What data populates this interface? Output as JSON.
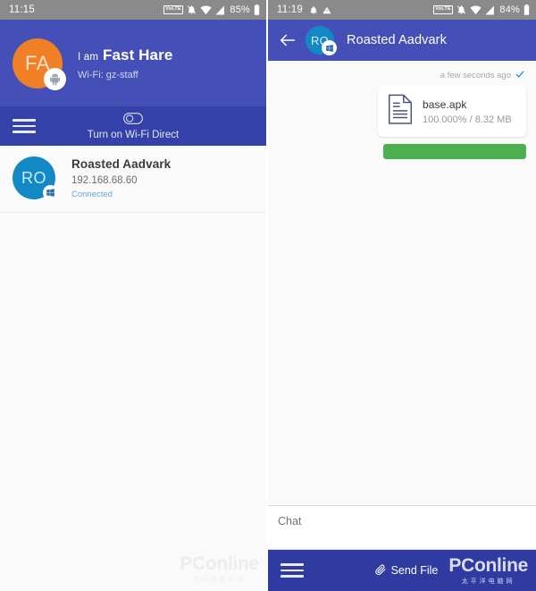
{
  "left_screen": {
    "status_bar": {
      "time": "11:15",
      "battery_percent": "85%",
      "icons": [
        "volte-icon",
        "notifications-muted-icon",
        "wifi-icon",
        "cellular-signal-icon",
        "battery-icon"
      ],
      "volte_label": "VoLTE"
    },
    "profile": {
      "avatar_initials": "FA",
      "avatar_color": "#ef8026",
      "badge_icon": "android-icon",
      "prefix": "I am",
      "name": "Fast Hare",
      "network": "Wi-Fi: gz-staff"
    },
    "wifi_direct_bar": {
      "menu_icon": "hamburger-menu-icon",
      "toggle_icon": "toggle-off-icon",
      "label": "Turn on Wi-Fi Direct",
      "background": "#3341a8"
    },
    "devices": [
      {
        "avatar_initials": "RO",
        "avatar_color": "#1288c4",
        "badge_icon": "windows-icon",
        "name": "Roasted Aadvark",
        "ip_address": "192.168.68.60",
        "status": "Connected",
        "status_color": "#6aa8dd"
      }
    ],
    "watermark": {
      "main": "PConline",
      "sub": "太平洋电脑网"
    }
  },
  "right_screen": {
    "status_bar": {
      "time": "11:19",
      "battery_percent": "84%",
      "icons": [
        "notification-bell-icon",
        "warning-icon",
        "volte-icon",
        "notifications-muted-icon",
        "wifi-icon",
        "cellular-signal-icon",
        "battery-icon"
      ],
      "volte_label": "VoLTE"
    },
    "app_bar": {
      "back_icon": "back-arrow-icon",
      "avatar_initials": "RO",
      "avatar_color": "#1288c4",
      "badge_icon": "windows-icon",
      "title": "Roasted Aadvark"
    },
    "messages": [
      {
        "timestamp": "a few seconds ago",
        "status_icon": "checkmark-icon",
        "status_color": "#2f86d8",
        "file_icon": "document-icon",
        "file_name": "base.apk",
        "file_meta": "100.000% / 8.32 MB",
        "progress_percent": 100,
        "progress_color": "#4caf50"
      }
    ],
    "chat_input": {
      "placeholder": "Chat",
      "value": ""
    },
    "bottom_bar": {
      "menu_icon": "hamburger-menu-icon",
      "attach_icon": "paperclip-icon",
      "send_file_label": "Send File",
      "background": "#2f3ba0"
    },
    "watermark": {
      "main": "PConline",
      "sub": "太平洋电脑网"
    }
  }
}
